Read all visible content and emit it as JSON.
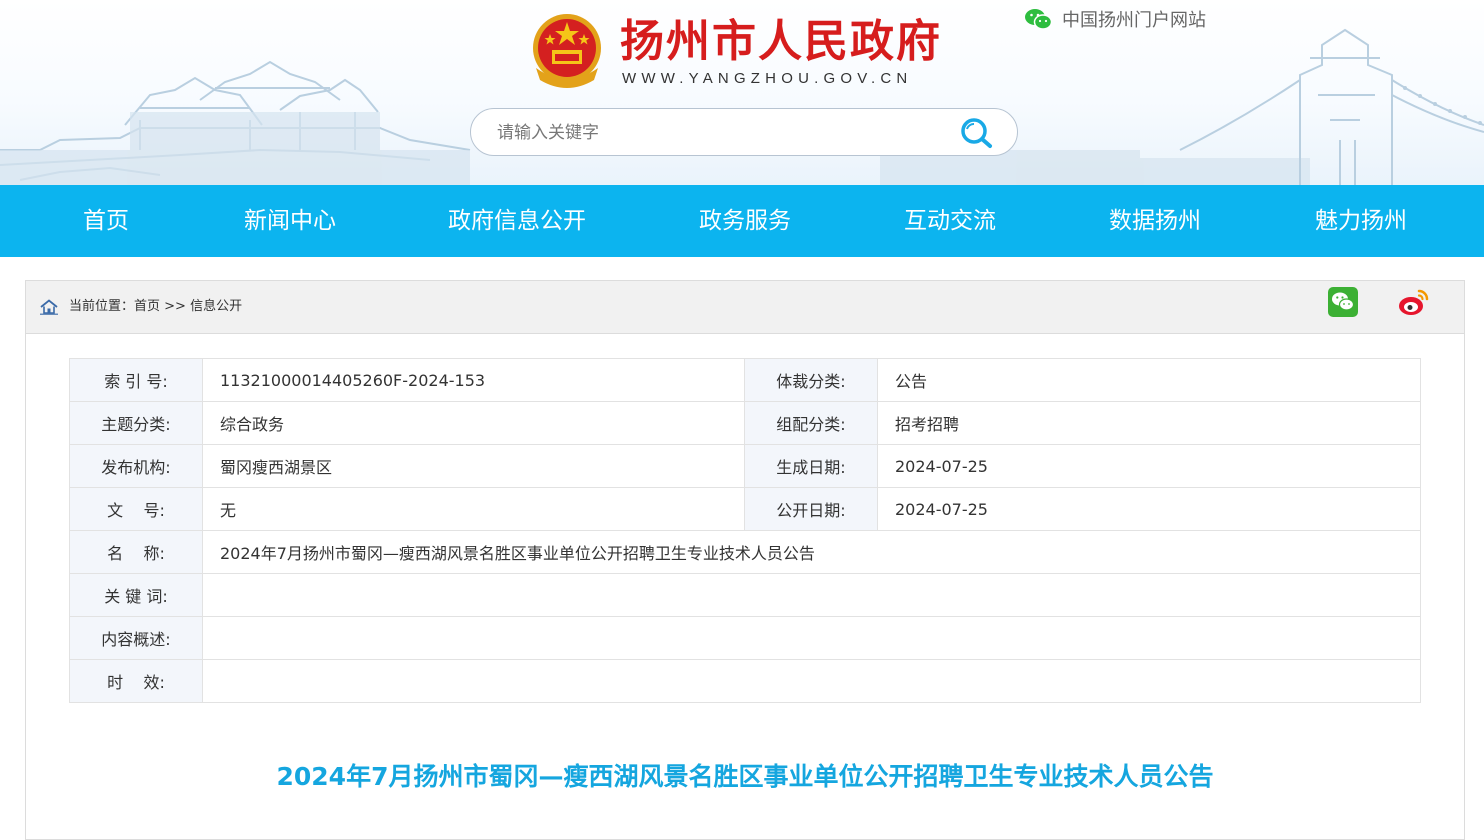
{
  "header": {
    "site_title": "扬州市人民政府",
    "site_domain": "WWW.YANGZHOU.GOV.CN",
    "portal_link": "中国扬州门户网站"
  },
  "search": {
    "placeholder": "请输入关键字"
  },
  "nav": {
    "items": [
      "首页",
      "新闻中心",
      "政府信息公开",
      "政务服务",
      "互动交流",
      "数据扬州",
      "魅力扬州"
    ]
  },
  "breadcrumb": {
    "prefix": "当前位置：",
    "home": "首页",
    "separator": " >> ",
    "current": "信息公开"
  },
  "meta": {
    "index_label": "索 引 号:",
    "index_value": "11321000014405260F-2024-153",
    "genre_label": "体裁分类:",
    "genre_value": "公告",
    "topic_label": "主题分类:",
    "topic_value": "综合政务",
    "category_label": "组配分类:",
    "category_value": "招考招聘",
    "org_label": "发布机构:",
    "org_value": "蜀冈瘦西湖景区",
    "created_label": "生成日期:",
    "created_value": "2024-07-25",
    "docno_label": "文    号:",
    "docno_value": "无",
    "public_label": "公开日期:",
    "public_value": "2024-07-25",
    "name_label": "名    称:",
    "name_value": "2024年7月扬州市蜀冈—瘦西湖风景名胜区事业单位公开招聘卫生专业技术人员公告",
    "keywords_label": "关 键 词:",
    "keywords_value": "",
    "summary_label": "内容概述:",
    "summary_value": "",
    "validity_label": "时    效:",
    "validity_value": ""
  },
  "article": {
    "title": "2024年7月扬州市蜀冈—瘦西湖风景名胜区事业单位公开招聘卫生专业技术人员公告"
  },
  "colors": {
    "nav_bg": "#0cb4ef",
    "title_red": "#d61d1d",
    "article_title": "#15a6df",
    "label_bg": "#f3f6fb"
  },
  "icons": {
    "emblem": "national-emblem-icon",
    "portal": "wechat-bubbles-icon",
    "search": "magnifier-icon",
    "home": "home-icon",
    "share_wechat": "wechat-icon",
    "share_weibo": "weibo-icon"
  }
}
